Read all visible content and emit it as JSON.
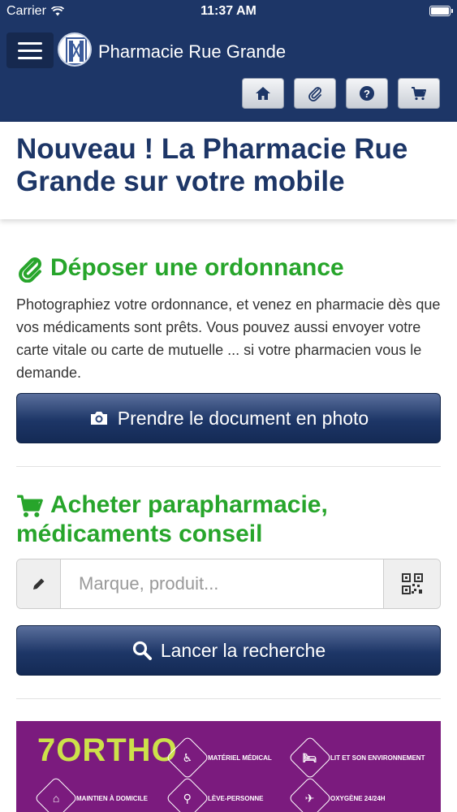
{
  "status_bar": {
    "carrier": "Carrier",
    "time": "11:37 AM"
  },
  "header": {
    "title": "Pharmacie Rue Grande",
    "buttons": [
      {
        "icon": "home-icon"
      },
      {
        "icon": "paperclip-icon"
      },
      {
        "icon": "help-icon"
      },
      {
        "icon": "cart-icon"
      }
    ]
  },
  "intro": {
    "heading": "Nouveau ! La Pharmacie Rue Grande sur votre mobile"
  },
  "prescription": {
    "title": "Déposer une ordonnance",
    "text": "Photographiez votre ordonnance, et venez en pharmacie dès que vos médicaments sont prêts. Vous pouvez aussi envoyer votre carte vitale ou carte de mutuelle ... si votre pharmacien vous le demande.",
    "button_label": "Prendre le document en photo"
  },
  "shop": {
    "title": "Acheter parapharmacie, médicaments conseil",
    "search_placeholder": "Marque, produit...",
    "search_value": "",
    "button_label": "Lancer la recherche"
  },
  "banner": {
    "brand": "7ORTHO",
    "items": [
      "MATÉRIEL MÉDICAL",
      "LIT ET SON ENVIRONNEMENT",
      "MAINTIEN À DOMICILE",
      "LÈVE-PERSONNE",
      "OXYGÈNE 24/24H"
    ]
  },
  "colors": {
    "brand_blue": "#1d3667",
    "accent_green": "#27a52b",
    "banner_purple": "#7b1b7e",
    "banner_lime": "#cde14a"
  }
}
